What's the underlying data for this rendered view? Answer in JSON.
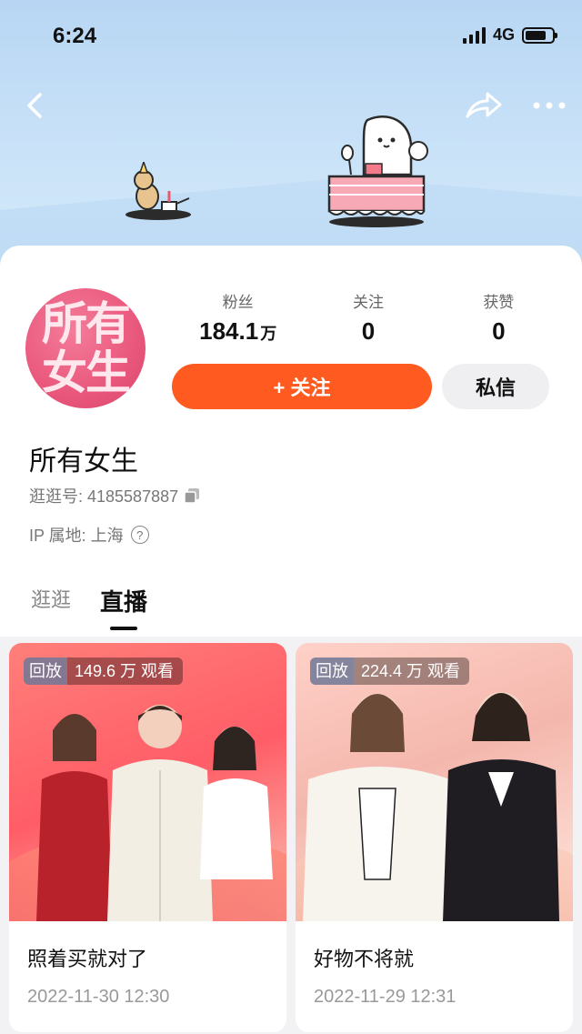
{
  "status_bar": {
    "time": "6:24",
    "network": "4G"
  },
  "profile": {
    "avatar_line1": "所有",
    "avatar_line2": "女生",
    "name": "所有女生",
    "account_label": "逛逛号: 4185587887",
    "ip_label": "IP 属地: 上海"
  },
  "stats": [
    {
      "label": "粉丝",
      "value": "184.1",
      "unit": "万"
    },
    {
      "label": "关注",
      "value": "0",
      "unit": ""
    },
    {
      "label": "获赞",
      "value": "0",
      "unit": ""
    }
  ],
  "actions": {
    "follow_label": "+ 关注",
    "message_label": "私信"
  },
  "tabs": [
    {
      "label": "逛逛",
      "active": false
    },
    {
      "label": "直播",
      "active": true
    }
  ],
  "cards": [
    {
      "badge": "回放",
      "views": "149.6 万 观看",
      "title": "照着买就对了",
      "time": "2022-11-30 12:30"
    },
    {
      "badge": "回放",
      "views": "224.4 万 观看",
      "title": "好物不将就",
      "time": "2022-11-29 12:31"
    }
  ],
  "colors": {
    "accent": "#ff5a1f",
    "header_sky": "#c9e2f8"
  }
}
